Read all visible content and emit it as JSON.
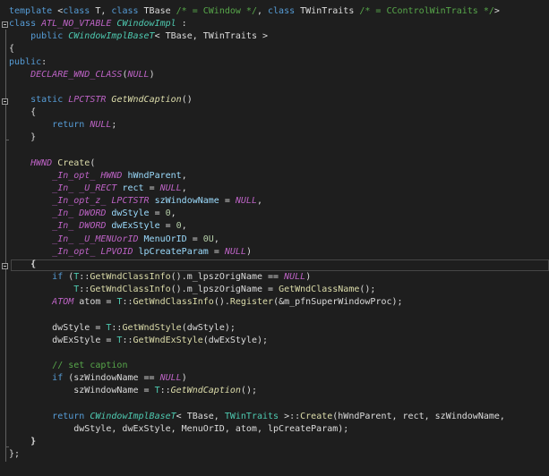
{
  "lines": [
    [
      {
        "t": "template ",
        "c": "kw"
      },
      {
        "t": "<"
      },
      {
        "t": "class ",
        "c": "kw"
      },
      {
        "t": "T, "
      },
      {
        "t": "class ",
        "c": "kw"
      },
      {
        "t": "TBase "
      },
      {
        "t": "/* = CWindow */",
        "c": "cm"
      },
      {
        "t": ", "
      },
      {
        "t": "class ",
        "c": "kw"
      },
      {
        "t": "TWinTraits "
      },
      {
        "t": "/* = CControlWinTraits */",
        "c": "cm"
      },
      {
        "t": ">"
      }
    ],
    [
      {
        "t": "class ",
        "c": "kw"
      },
      {
        "t": "ATL_NO_VTABLE ",
        "c": "mac"
      },
      {
        "t": "CWindowImpl ",
        "c": "cls"
      },
      {
        "t": ":"
      }
    ],
    [
      {
        "t": "    "
      },
      {
        "t": "public ",
        "c": "kw"
      },
      {
        "t": "CWindowImplBaseT",
        "c": "cls"
      },
      {
        "t": "< TBase, TWinTraits >"
      }
    ],
    [
      {
        "t": "{"
      }
    ],
    [
      {
        "t": "public",
        "c": "kw"
      },
      {
        "t": ":"
      }
    ],
    [
      {
        "t": "    "
      },
      {
        "t": "DECLARE_WND_CLASS",
        "c": "mac"
      },
      {
        "t": "("
      },
      {
        "t": "NULL",
        "c": "mac"
      },
      {
        "t": ")"
      }
    ],
    [],
    [
      {
        "t": "    "
      },
      {
        "t": "static ",
        "c": "kw"
      },
      {
        "t": "LPCTSTR ",
        "c": "mac"
      },
      {
        "t": "GetWndCaption",
        "c": "fni"
      },
      {
        "t": "()"
      }
    ],
    [
      {
        "t": "    {"
      }
    ],
    [
      {
        "t": "        "
      },
      {
        "t": "return ",
        "c": "kw"
      },
      {
        "t": "NULL",
        "c": "mac"
      },
      {
        "t": ";"
      }
    ],
    [
      {
        "t": "    }"
      }
    ],
    [],
    [
      {
        "t": "    "
      },
      {
        "t": "HWND ",
        "c": "mac"
      },
      {
        "t": "Create",
        "c": "fn"
      },
      {
        "t": "("
      }
    ],
    [
      {
        "t": "        "
      },
      {
        "t": "_In_opt_ ",
        "c": "mac"
      },
      {
        "t": "HWND ",
        "c": "mac"
      },
      {
        "t": "hWndParent",
        "c": "par"
      },
      {
        "t": ","
      }
    ],
    [
      {
        "t": "        "
      },
      {
        "t": "_In_ ",
        "c": "mac"
      },
      {
        "t": "_U_RECT ",
        "c": "mac"
      },
      {
        "t": "rect",
        "c": "par"
      },
      {
        "t": " = "
      },
      {
        "t": "NULL",
        "c": "mac"
      },
      {
        "t": ","
      }
    ],
    [
      {
        "t": "        "
      },
      {
        "t": "_In_opt_z_ ",
        "c": "mac"
      },
      {
        "t": "LPCTSTR ",
        "c": "mac"
      },
      {
        "t": "szWindowName",
        "c": "par"
      },
      {
        "t": " = "
      },
      {
        "t": "NULL",
        "c": "mac"
      },
      {
        "t": ","
      }
    ],
    [
      {
        "t": "        "
      },
      {
        "t": "_In_ ",
        "c": "mac"
      },
      {
        "t": "DWORD ",
        "c": "mac"
      },
      {
        "t": "dwStyle",
        "c": "par"
      },
      {
        "t": " = "
      },
      {
        "t": "0",
        "c": "num"
      },
      {
        "t": ","
      }
    ],
    [
      {
        "t": "        "
      },
      {
        "t": "_In_ ",
        "c": "mac"
      },
      {
        "t": "DWORD ",
        "c": "mac"
      },
      {
        "t": "dwExStyle",
        "c": "par"
      },
      {
        "t": " = "
      },
      {
        "t": "0",
        "c": "num"
      },
      {
        "t": ","
      }
    ],
    [
      {
        "t": "        "
      },
      {
        "t": "_In_ ",
        "c": "mac"
      },
      {
        "t": "_U_MENUorID ",
        "c": "mac"
      },
      {
        "t": "MenuOrID",
        "c": "par"
      },
      {
        "t": " = "
      },
      {
        "t": "0U",
        "c": "num"
      },
      {
        "t": ","
      }
    ],
    [
      {
        "t": "        "
      },
      {
        "t": "_In_opt_ ",
        "c": "mac"
      },
      {
        "t": "LPVOID ",
        "c": "mac"
      },
      {
        "t": "lpCreateParam",
        "c": "par"
      },
      {
        "t": " = "
      },
      {
        "t": "NULL",
        "c": "mac"
      },
      {
        "t": ")"
      }
    ],
    [
      {
        "t": "    "
      },
      {
        "t": "{",
        "c": "bold"
      }
    ],
    [
      {
        "t": "        "
      },
      {
        "t": "if ",
        "c": "kw"
      },
      {
        "t": "("
      },
      {
        "t": "T",
        "c": "ty"
      },
      {
        "t": "::"
      },
      {
        "t": "GetWndClassInfo",
        "c": "fn"
      },
      {
        "t": "().m_lpszOrigName == "
      },
      {
        "t": "NULL",
        "c": "mac"
      },
      {
        "t": ")"
      }
    ],
    [
      {
        "t": "            "
      },
      {
        "t": "T",
        "c": "ty"
      },
      {
        "t": "::"
      },
      {
        "t": "GetWndClassInfo",
        "c": "fn"
      },
      {
        "t": "().m_lpszOrigName = "
      },
      {
        "t": "GetWndClassName",
        "c": "fn"
      },
      {
        "t": "();"
      }
    ],
    [
      {
        "t": "        "
      },
      {
        "t": "ATOM ",
        "c": "mac"
      },
      {
        "t": "atom = "
      },
      {
        "t": "T",
        "c": "ty"
      },
      {
        "t": "::"
      },
      {
        "t": "GetWndClassInfo",
        "c": "fn"
      },
      {
        "t": "()."
      },
      {
        "t": "Register",
        "c": "fn"
      },
      {
        "t": "(&m_pfnSuperWindowProc);"
      }
    ],
    [],
    [
      {
        "t": "        dwStyle = "
      },
      {
        "t": "T",
        "c": "ty"
      },
      {
        "t": "::"
      },
      {
        "t": "GetWndStyle",
        "c": "fn"
      },
      {
        "t": "(dwStyle);"
      }
    ],
    [
      {
        "t": "        dwExStyle = "
      },
      {
        "t": "T",
        "c": "ty"
      },
      {
        "t": "::"
      },
      {
        "t": "GetWndExStyle",
        "c": "fn"
      },
      {
        "t": "(dwExStyle);"
      }
    ],
    [],
    [
      {
        "t": "        "
      },
      {
        "t": "// set caption",
        "c": "cm"
      }
    ],
    [
      {
        "t": "        "
      },
      {
        "t": "if ",
        "c": "kw"
      },
      {
        "t": "(szWindowName == "
      },
      {
        "t": "NULL",
        "c": "mac"
      },
      {
        "t": ")"
      }
    ],
    [
      {
        "t": "            szWindowName = "
      },
      {
        "t": "T",
        "c": "ty"
      },
      {
        "t": "::"
      },
      {
        "t": "GetWndCaption",
        "c": "fni"
      },
      {
        "t": "();"
      }
    ],
    [],
    [
      {
        "t": "        "
      },
      {
        "t": "return ",
        "c": "kw"
      },
      {
        "t": "CWindowImplBaseT",
        "c": "cls"
      },
      {
        "t": "< TBase, "
      },
      {
        "t": "TWinTraits ",
        "c": "ty"
      },
      {
        "t": ">::"
      },
      {
        "t": "Create",
        "c": "fn"
      },
      {
        "t": "(hWndParent, rect, szWindowName,"
      }
    ],
    [
      {
        "t": "            dwStyle, dwExStyle, MenuOrID, atom, lpCreateParam);"
      }
    ],
    [
      {
        "t": "    "
      },
      {
        "t": "}",
        "c": "bold"
      }
    ],
    [
      {
        "t": "};"
      }
    ]
  ]
}
